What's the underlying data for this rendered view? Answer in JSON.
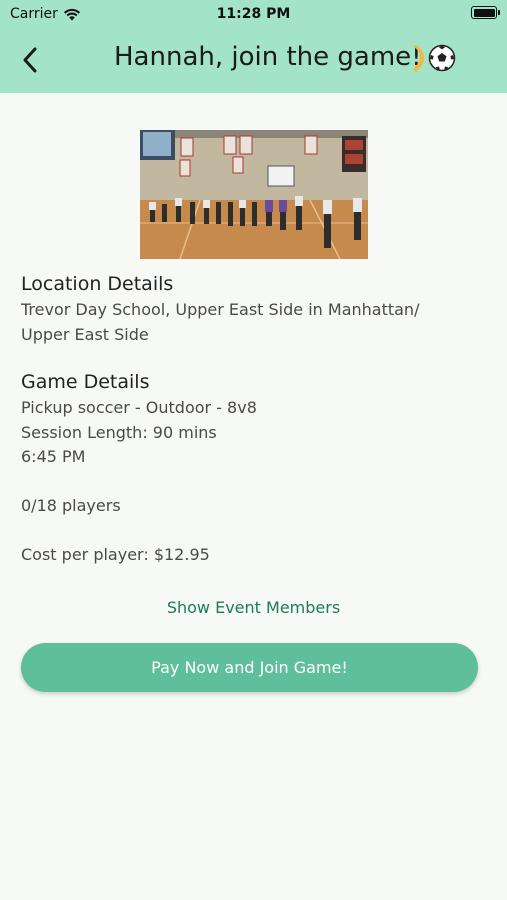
{
  "status_bar": {
    "carrier": "Carrier",
    "time": "11:28 PM"
  },
  "header": {
    "title": "Hannah, join the game!",
    "title_icons": [
      "leg-icon",
      "soccer-ball-icon"
    ],
    "background": "#a3e3c7"
  },
  "location": {
    "heading": "Location Details",
    "line1": "Trevor Day School, Upper East Side in Manhattan/",
    "line2": "Upper East Side"
  },
  "game": {
    "heading": "Game Details",
    "type": "Pickup soccer - Outdoor - 8v8",
    "session_length": "Session Length: 90 mins",
    "time": "6:45 PM",
    "players": "0/18 players",
    "cost": "Cost per player: $12.95"
  },
  "actions": {
    "members_link": "Show Event Members",
    "join_button": "Pay Now and Join Game!",
    "accent": "#5fbe9c",
    "link_color": "#1f7a5c"
  }
}
